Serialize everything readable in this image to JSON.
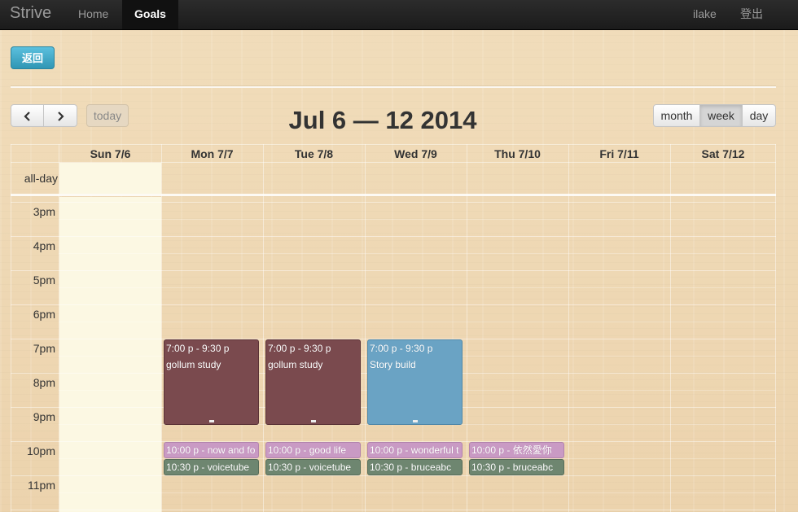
{
  "navbar": {
    "brand": "Strive",
    "items": [
      {
        "label": "Home",
        "active": false
      },
      {
        "label": "Goals",
        "active": true
      }
    ],
    "user": "ilake",
    "logout": "登出"
  },
  "back_button": "返回",
  "toolbar": {
    "prev_icon": "chevron-left-icon",
    "next_icon": "chevron-right-icon",
    "today": "today",
    "title": "Jul 6 — 12 2014",
    "views": [
      {
        "label": "month",
        "active": false
      },
      {
        "label": "week",
        "active": true
      },
      {
        "label": "day",
        "active": false
      }
    ]
  },
  "calendar": {
    "allday_label": "all-day",
    "days": [
      "Sun 7/6",
      "Mon 7/7",
      "Tue 7/8",
      "Wed 7/9",
      "Thu 7/10",
      "Fri 7/11",
      "Sat 7/12"
    ],
    "today_index": 0,
    "times": [
      "3pm",
      "4pm",
      "5pm",
      "6pm",
      "7pm",
      "8pm",
      "9pm",
      "10pm",
      "11pm"
    ]
  },
  "events": [
    {
      "day": "Mon 7/7",
      "time": "7:00 p - 9:30 p",
      "title": "gollum study",
      "color": "#7a4a4e"
    },
    {
      "day": "Tue 7/8",
      "time": "7:00 p - 9:30 p",
      "title": "gollum study",
      "color": "#7a4a4e"
    },
    {
      "day": "Wed 7/9",
      "time": "7:00 p - 9:30 p",
      "title": "Story build",
      "color": "#6aa3c4"
    },
    {
      "day": "Mon 7/7",
      "label": "10:00 p - now and fo",
      "color": "#c99ac4"
    },
    {
      "day": "Tue 7/8",
      "label": "10:00 p - good life",
      "color": "#c99ac4"
    },
    {
      "day": "Wed 7/9",
      "label": "10:00 p - wonderful t",
      "color": "#c99ac4"
    },
    {
      "day": "Thu 7/10",
      "label": "10:00 p - 依然愛你",
      "color": "#c99ac4"
    },
    {
      "day": "Mon 7/7",
      "label": "10:30 p - voicetube",
      "color": "#6e8670"
    },
    {
      "day": "Tue 7/8",
      "label": "10:30 p - voicetube",
      "color": "#6e8670"
    },
    {
      "day": "Wed 7/9",
      "label": "10:30 p - bruceabc",
      "color": "#6e8670"
    },
    {
      "day": "Thu 7/10",
      "label": "10:30 p - bruceabc",
      "color": "#6e8670"
    }
  ]
}
